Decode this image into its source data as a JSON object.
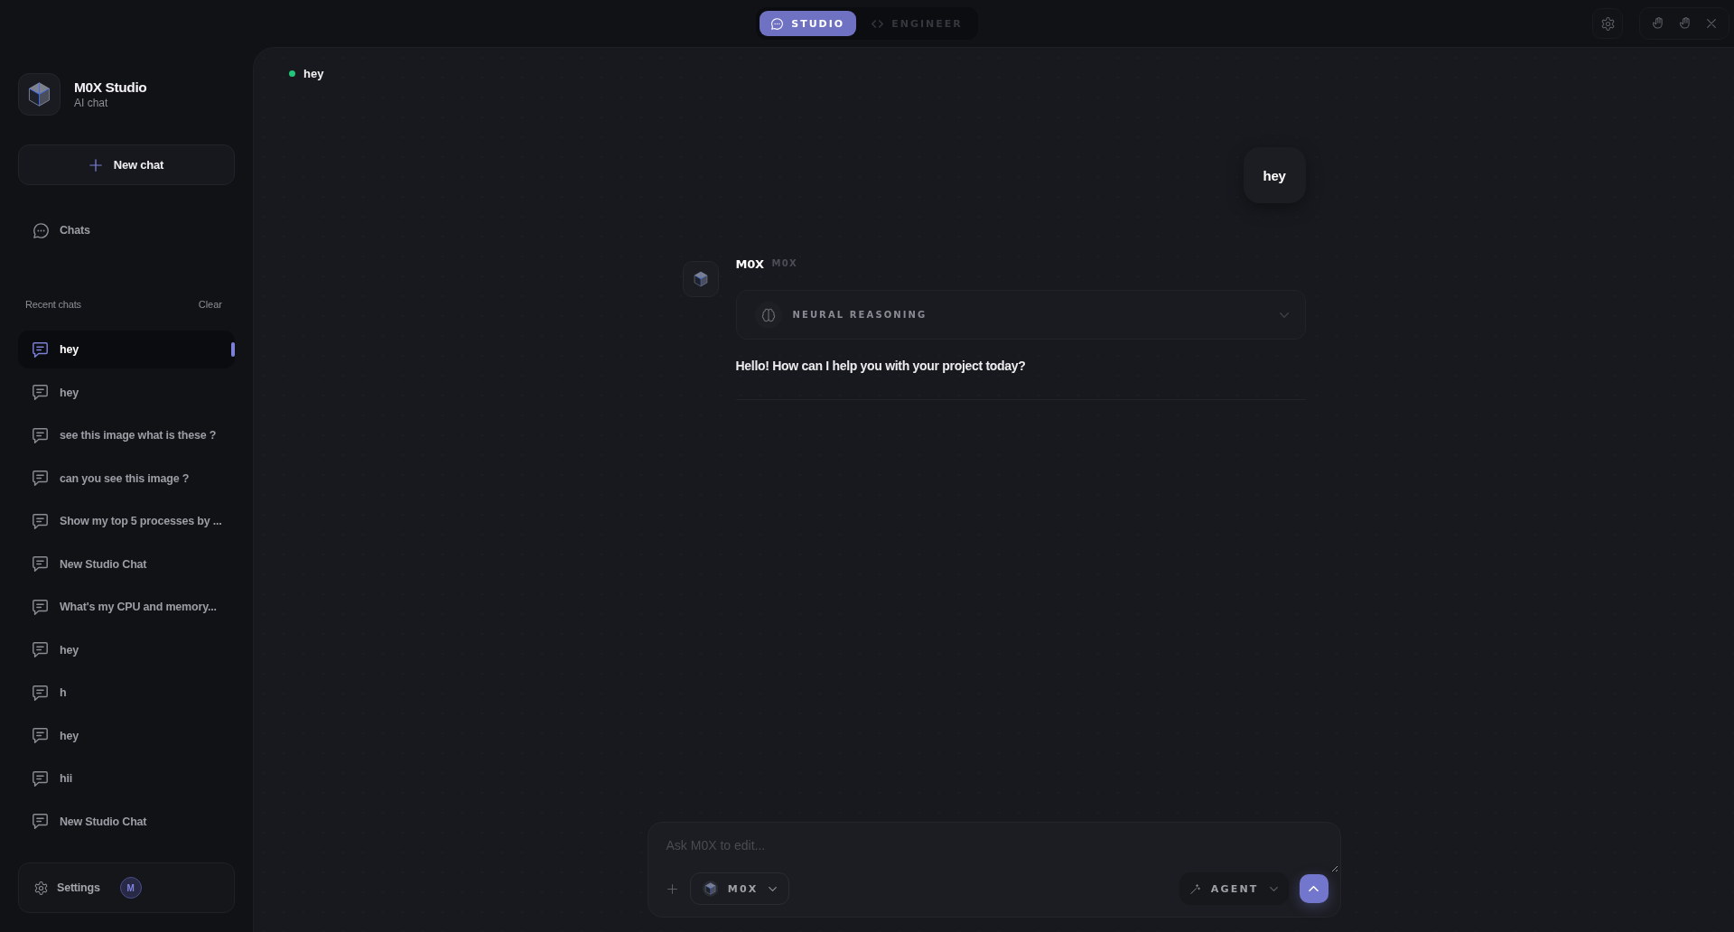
{
  "top_bar": {
    "mode_tabs": [
      {
        "label": "STUDIO",
        "selected": true
      },
      {
        "label": "ENGINEER",
        "selected": false
      }
    ]
  },
  "sidebar": {
    "app_name": "M0X Studio",
    "app_subtitle": "AI chat",
    "new_chat": "New chat",
    "nav": [
      {
        "label": "Chats"
      }
    ],
    "recent_title": "Recent chats",
    "clear": "Clear",
    "recent_chats": [
      {
        "title": "hey",
        "selected": true
      },
      {
        "title": "hey",
        "selected": false
      },
      {
        "title": "see this image what is these ?",
        "selected": false
      },
      {
        "title": "can you see this image ?",
        "selected": false
      },
      {
        "title": "Show my top 5 processes by ...",
        "selected": false
      },
      {
        "title": "New Studio Chat",
        "selected": false
      },
      {
        "title": "What's my CPU and memory...",
        "selected": false
      },
      {
        "title": "hey",
        "selected": false
      },
      {
        "title": "h",
        "selected": false
      },
      {
        "title": "hey",
        "selected": false
      },
      {
        "title": "hii",
        "selected": false
      },
      {
        "title": "New Studio Chat",
        "selected": false
      }
    ],
    "footer": {
      "settings": "Settings",
      "avatar_initial": "M"
    }
  },
  "chat": {
    "title": "hey",
    "online": true,
    "messages": [
      {
        "kind": "user",
        "text": "hey"
      },
      {
        "kind": "assistant",
        "author": "M0X",
        "model": "M0X",
        "reasoning": {
          "label": "NEURAL REASONING",
          "expanded": false
        },
        "text": "Hello! How can I help you with your project today?"
      }
    ]
  },
  "composer": {
    "placeholder": "Ask M0X to edit...",
    "model": "M0X",
    "mode": "AGENT"
  }
}
